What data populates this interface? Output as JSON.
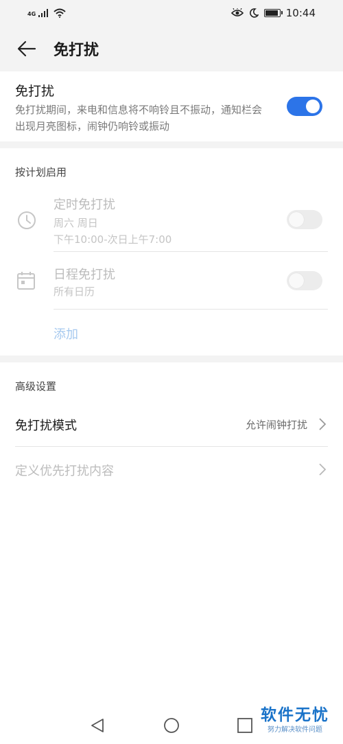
{
  "status_bar": {
    "network": "4G",
    "time": "10:44",
    "battery_level": 0.9
  },
  "header": {
    "title": "免打扰"
  },
  "dnd": {
    "title": "免打扰",
    "description": "免打扰期间，来电和信息将不响铃且不振动，通知栏会出现月亮图标，闹钟仍响铃或振动",
    "enabled": true
  },
  "schedule": {
    "section_label": "按计划启用",
    "items": [
      {
        "title": "定时免打扰",
        "sub1": "周六 周日",
        "sub2": "下午10:00-次日上午7:00",
        "enabled": false,
        "icon": "clock-icon"
      },
      {
        "title": "日程免打扰",
        "sub1": "所有日历",
        "enabled": false,
        "icon": "calendar-icon"
      }
    ],
    "add_label": "添加"
  },
  "advanced": {
    "section_label": "高级设置",
    "mode_title": "免打扰模式",
    "mode_value": "允许闹钟打扰",
    "priority_title": "定义优先打扰内容"
  },
  "watermark": {
    "main": "软件无忧",
    "sub": "努力解决软件问题"
  },
  "colors": {
    "accent": "#2c74e8",
    "disabled_text": "#bcbcbc",
    "link_disabled": "#a6c9ef",
    "background": "#f3f3f3"
  }
}
